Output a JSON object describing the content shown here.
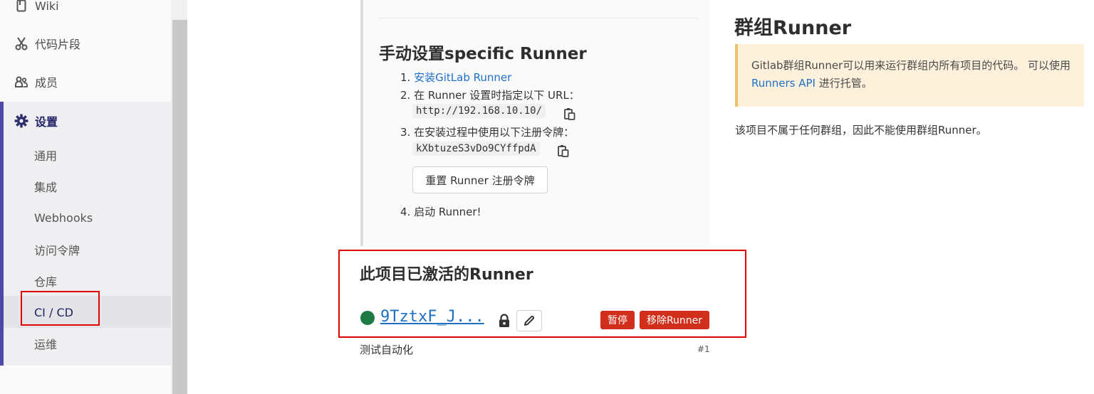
{
  "sidebar": {
    "items": [
      {
        "label": "Wiki",
        "icon": "book-icon"
      },
      {
        "label": "代码片段",
        "icon": "scissors-icon"
      },
      {
        "label": "成员",
        "icon": "users-icon"
      }
    ],
    "settings": {
      "label": "设置",
      "icon": "gear-icon",
      "subitems": [
        "通用",
        "集成",
        "Webhooks",
        "访问令牌",
        "仓库",
        "CI / CD",
        "运维"
      ],
      "active": "CI / CD"
    }
  },
  "specific": {
    "title": "手动设置specific Runner",
    "step1_prefix": "1. ",
    "step1_link": "安装GitLab Runner",
    "step2": "2. 在 Runner 设置时指定以下 URL：",
    "url": "http://192.168.10.10/",
    "step3": "3. 在安装过程中使用以下注册令牌：",
    "token": "kXbtuzeS3vDo9CYffpdA",
    "reset_button": "重置 Runner 注册令牌",
    "step4": "4. 启动 Runner!"
  },
  "active_runners": {
    "title": "此项目已激活的Runner",
    "runner_id": "9TztxF_J...",
    "pause_button": "暂停",
    "remove_button": "移除Runner",
    "description": "测试自动化",
    "number": "#1",
    "status_color": "#1e7a45"
  },
  "group": {
    "title": "群组Runner",
    "alert_text_1": "Gitlab群组Runner可以用来运行群组内所有项目的代码。 可以使用 ",
    "alert_link": "Runners API",
    "alert_text_2": " 进行托管。",
    "note": "该项目不属于任何群组，因此不能使用群组Runner。"
  }
}
